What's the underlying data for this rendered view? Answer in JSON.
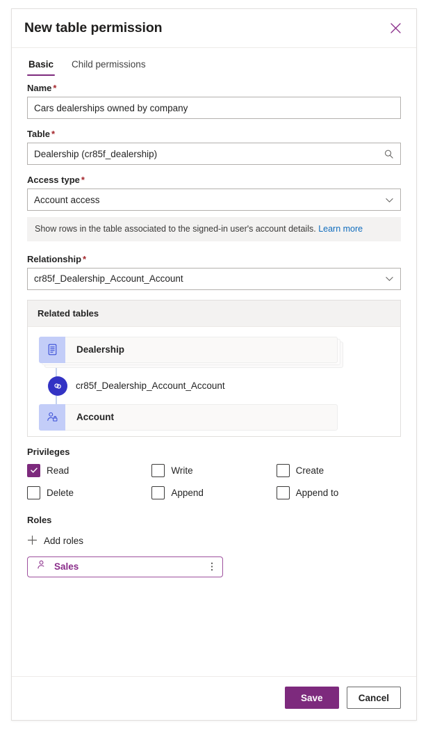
{
  "dialog": {
    "title": "New table permission",
    "close_icon": "close-icon"
  },
  "tabs": [
    {
      "label": "Basic",
      "active": true
    },
    {
      "label": "Child permissions",
      "active": false
    }
  ],
  "fields": {
    "name": {
      "label": "Name",
      "required": "*",
      "value": "Cars dealerships owned by company"
    },
    "table": {
      "label": "Table",
      "required": "*",
      "value": "Dealership (cr85f_dealership)",
      "trailing_icon": "search-icon"
    },
    "access_type": {
      "label": "Access type",
      "required": "*",
      "value": "Account access",
      "trailing_icon": "chevron-down-icon",
      "info_text": "Show rows in the table associated to the signed-in user's account details.",
      "info_link": "Learn more"
    },
    "relationship": {
      "label": "Relationship",
      "required": "*",
      "value": "cr85f_Dealership_Account_Account",
      "trailing_icon": "chevron-down-icon"
    }
  },
  "related_tables": {
    "header": "Related tables",
    "source_node": {
      "label": "Dealership",
      "icon": "table-document-icon"
    },
    "relationship_node": {
      "label": "cr85f_Dealership_Account_Account",
      "icon": "link-icon"
    },
    "target_node": {
      "label": "Account",
      "icon": "person-lock-icon"
    }
  },
  "privileges": {
    "label": "Privileges",
    "items": [
      {
        "label": "Read",
        "checked": true
      },
      {
        "label": "Write",
        "checked": false
      },
      {
        "label": "Create",
        "checked": false
      },
      {
        "label": "Delete",
        "checked": false
      },
      {
        "label": "Append",
        "checked": false
      },
      {
        "label": "Append to",
        "checked": false
      }
    ]
  },
  "roles": {
    "label": "Roles",
    "add_label": "Add roles",
    "add_icon": "plus-icon",
    "chips": [
      {
        "name": "Sales",
        "icon": "person-role-icon",
        "more_icon": "more-vertical-icon"
      }
    ]
  },
  "footer": {
    "save_label": "Save",
    "cancel_label": "Cancel"
  },
  "colors": {
    "accent_purple": "#7d2a7d",
    "link_blue": "#0f6cbd",
    "required_red": "#a4262c",
    "node_icon_bg": "#c3cdf8",
    "link_badge_bg": "#3333c4"
  }
}
